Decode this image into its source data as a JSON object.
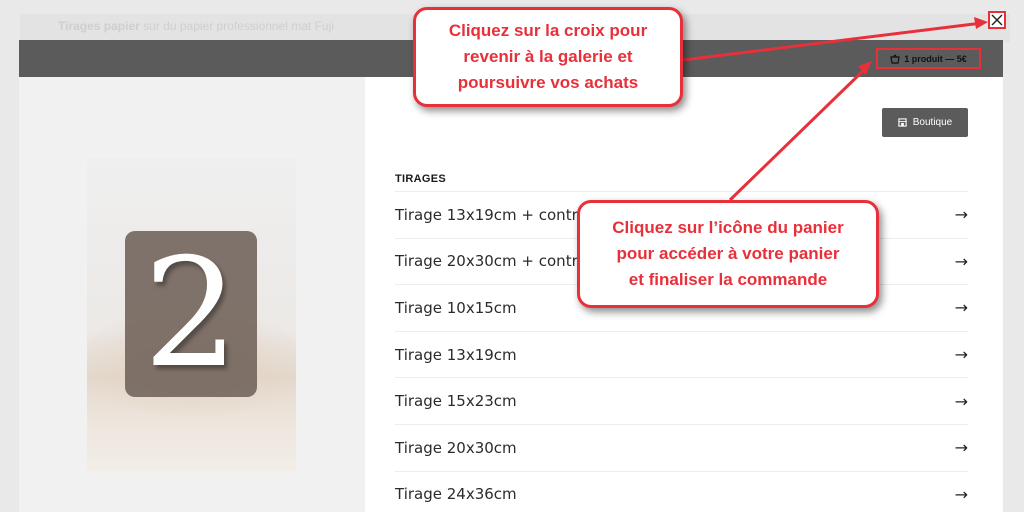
{
  "background": {
    "title": "Tirages papier",
    "subtitle": "sur du papier professionnel mat Fuji"
  },
  "header": {
    "cart_label": "1 produit — 5€",
    "cart_icon": "basket-icon"
  },
  "photo": {
    "number": "2"
  },
  "shop": {
    "button_label": "Boutique",
    "button_icon": "store-icon"
  },
  "products": {
    "section_title": "TIRAGES",
    "items": [
      {
        "label": "Tirage 13x19cm + contre"
      },
      {
        "label": "Tirage 20x30cm + contr"
      },
      {
        "label": "Tirage 10x15cm"
      },
      {
        "label": "Tirage 13x19cm"
      },
      {
        "label": "Tirage 15x23cm"
      },
      {
        "label": "Tirage 20x30cm"
      },
      {
        "label": "Tirage 24x36cm"
      }
    ],
    "arrow": "→"
  },
  "annotations": {
    "close_hint": "Cliquez sur la croix pour\nrevenir à la galerie et\npoursuivre vos achats",
    "cart_hint": "Cliquez sur l’icône du panier\npour accéder à votre panier\net finaliser la commande"
  },
  "colors": {
    "accent": "#e8303a",
    "header_bg": "#5b5b5b",
    "left_pane_bg": "#f1f1f1"
  }
}
